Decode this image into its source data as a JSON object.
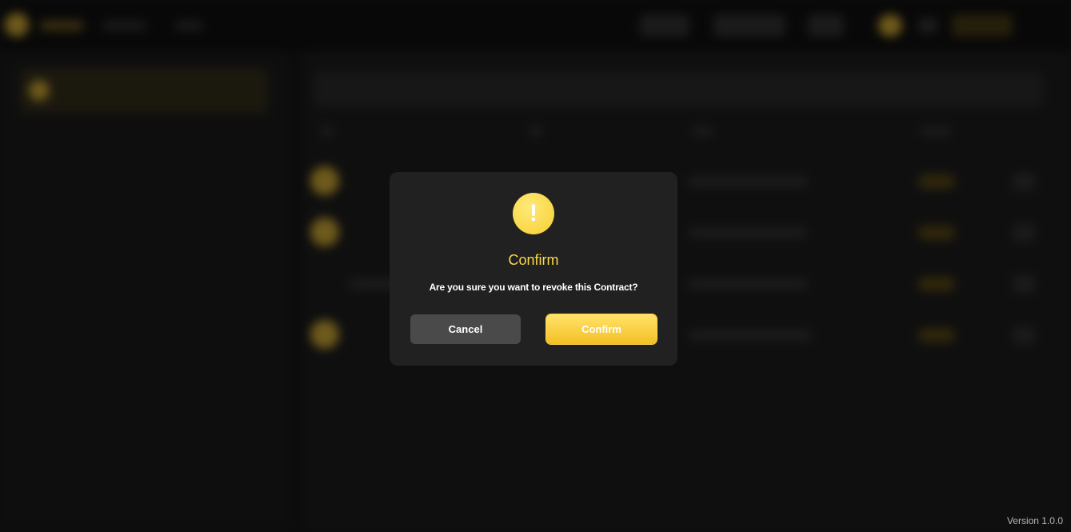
{
  "dialog": {
    "title": "Confirm",
    "message": "Are you sure you want to revoke this Contract?",
    "icon": "warning-icon",
    "cancel_label": "Cancel",
    "confirm_label": "Confirm"
  },
  "footer": {
    "version": "Version 1.0.0"
  },
  "colors": {
    "accent": "#f6cf2e",
    "title": "#fbd94e",
    "background": "#131313",
    "dialog_bg": "#212121"
  }
}
